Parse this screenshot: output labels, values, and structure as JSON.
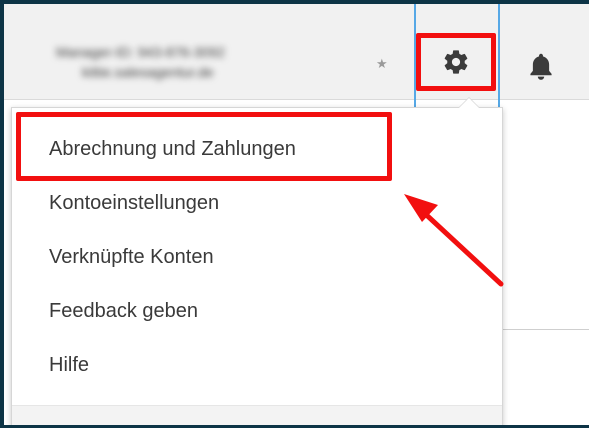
{
  "header": {
    "account_line_1": "Manager-ID: 943-876-3092",
    "account_line_2": "kittie.salesagentur.de"
  },
  "icons": {
    "settings": "gear-icon",
    "notifications": "bell-icon",
    "favorite": "star-icon"
  },
  "settings_menu": {
    "items": [
      "Abrechnung und Zahlungen",
      "Kontoeinstellungen",
      "Verknüpfte Konten",
      "Feedback geben",
      "Hilfe"
    ]
  },
  "colors": {
    "annotation": "#f20f0f",
    "frame": "#0d3446",
    "focus": "#56a8e6"
  }
}
